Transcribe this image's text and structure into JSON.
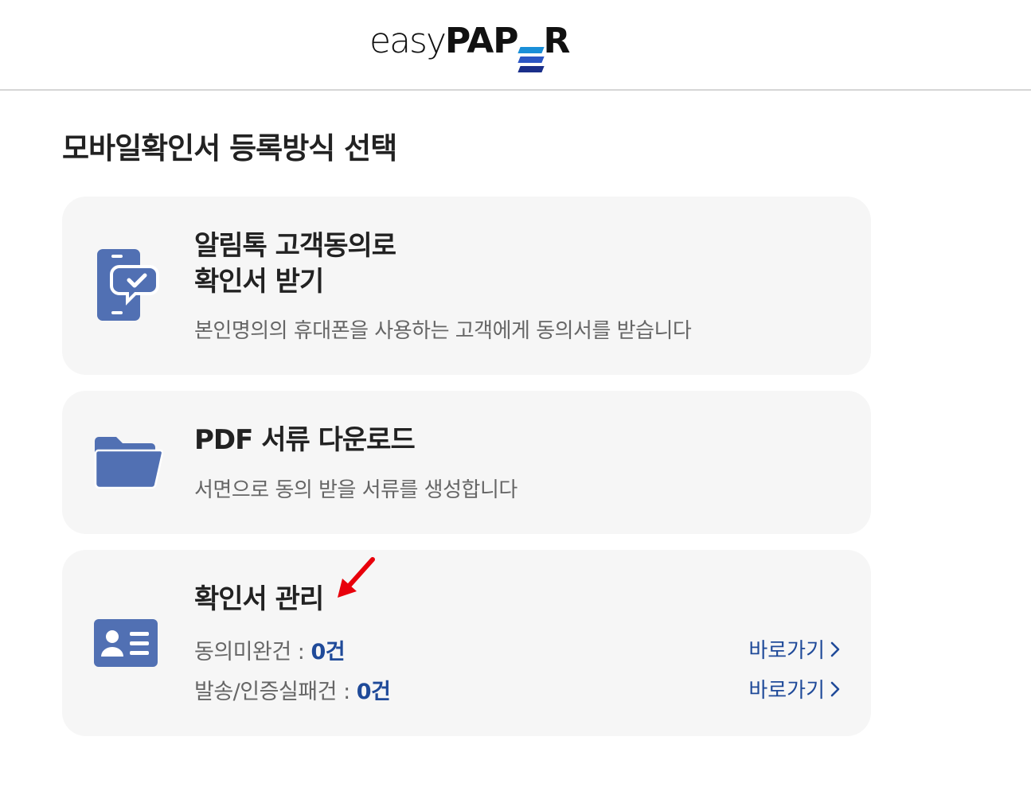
{
  "header": {
    "logo_easy": "easy",
    "logo_pa": "PAP",
    "logo_r": "R",
    "logo_e_colors": [
      "#1a8fd8",
      "#2b56c4",
      "#1a2f8a"
    ]
  },
  "page_title": "모바일확인서 등록방식 선택",
  "cards": [
    {
      "icon": "mobile-phone-check-icon",
      "title_line1": "알림톡 고객동의로",
      "title_line2": "확인서 받기",
      "description": "본인명의의 휴대폰을 사용하는 고객에게 동의서를 받습니다"
    },
    {
      "icon": "folder-icon",
      "title": "PDF 서류 다운로드",
      "description": "서면으로 동의 받을 서류를 생성합니다"
    },
    {
      "icon": "id-card-icon",
      "title": "확인서 관리",
      "stats": [
        {
          "label": "동의미완건",
          "separator": " : ",
          "value": "0건",
          "link": "바로가기"
        },
        {
          "label": "발송/인증실패건",
          "separator": " : ",
          "value": "0건",
          "link": "바로가기"
        }
      ]
    }
  ],
  "colors": {
    "icon_blue": "#5170b3",
    "link_blue": "#1f4a99",
    "annotation_red": "#e8000b",
    "card_bg": "#f6f6f6"
  }
}
